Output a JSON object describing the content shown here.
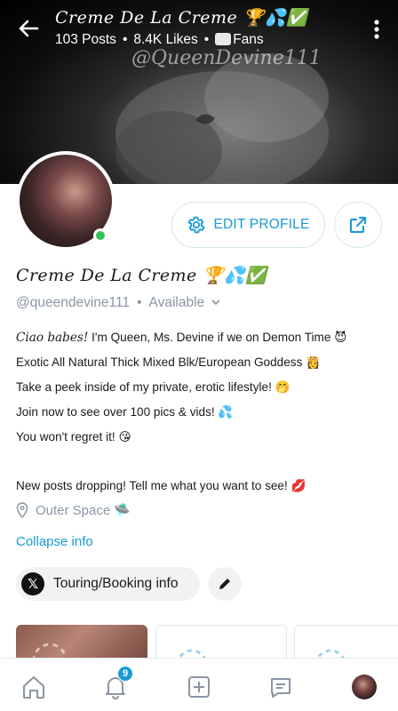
{
  "header": {
    "title": "Creme De La Creme 🏆💦✅",
    "posts": "103 Posts",
    "likes": "8.4K Likes",
    "fans": "Fans",
    "watermark": "@QueenDevine111"
  },
  "profile": {
    "edit_label": "EDIT PROFILE",
    "name": "Creme De La Creme 🏆💦✅",
    "handle": "@queendevine111",
    "status": "Available"
  },
  "bio": {
    "line1_prefix": "Ciao babes!",
    "line1_rest": " I'm Queen, Ms. Devine if we on Demon Time 😈",
    "line2": "Exotic All Natural Thick Mixed Blk/European Goddess 👸",
    "line3": "Take a peek inside of my private, erotic lifestyle! 🤭",
    "line4": "Join now to see over 100 pics & vids! 💦",
    "line5": "You won't regret it! 😘",
    "line6": "New posts dropping! Tell me what you want to see! 💋"
  },
  "location": "Outer Space 🛸",
  "collapse_label": "Collapse info",
  "touring_label": "Touring/Booking info",
  "nav": {
    "notification_count": "9"
  },
  "colors": {
    "accent": "#1b9bd6",
    "online": "#37c15a"
  }
}
